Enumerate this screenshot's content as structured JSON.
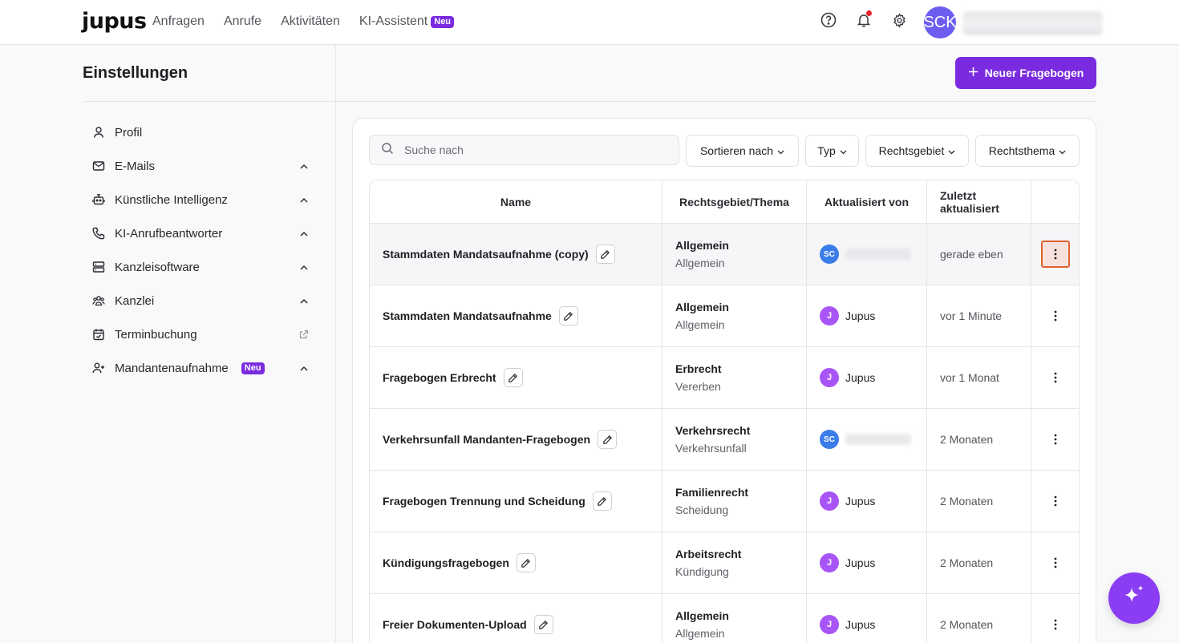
{
  "brand": {
    "logo": "jupus"
  },
  "nav": {
    "links": [
      "Anfragen",
      "Anrufe",
      "Aktivitäten",
      "KI-Assistent"
    ],
    "new_badge": "Neu"
  },
  "user": {
    "initials": "SCK"
  },
  "sidebar": {
    "title": "Einstellungen",
    "items": [
      {
        "label": "Profil",
        "icon": "user-icon"
      },
      {
        "label": "E-Mails",
        "icon": "mail-icon"
      },
      {
        "label": "Künstliche Intelligenz",
        "icon": "robot-icon"
      },
      {
        "label": "KI-Anrufbeantworter",
        "icon": "phone-icon"
      },
      {
        "label": "Kanzleisoftware",
        "icon": "server-icon"
      },
      {
        "label": "Kanzlei",
        "icon": "team-icon"
      },
      {
        "label": "Terminbuchung",
        "icon": "calendar-icon"
      },
      {
        "label": "Mandantenaufnahme",
        "icon": "user-plus-icon",
        "badge": "Neu"
      }
    ]
  },
  "toolbar": {
    "new_button": "Neuer Fragebogen",
    "search_placeholder": "Suche nach",
    "filters": [
      "Sortieren nach",
      "Typ",
      "Rechtsgebiet",
      "Rechtsthema"
    ]
  },
  "table": {
    "columns": [
      "Name",
      "Rechtsgebiet/Thema",
      "Aktualisiert von",
      "Zuletzt aktualisiert"
    ],
    "rows": [
      {
        "name": "Stammdaten Mandatsaufnahme (copy)",
        "area": "Allgemein",
        "topic": "Allgemein",
        "by_initials": "SC",
        "by_name": "",
        "updated": "gerade eben"
      },
      {
        "name": "Stammdaten Mandatsaufnahme",
        "area": "Allgemein",
        "topic": "Allgemein",
        "by_initials": "J",
        "by_name": "Jupus",
        "updated": "vor 1 Minute"
      },
      {
        "name": "Fragebogen Erbrecht",
        "area": "Erbrecht",
        "topic": "Vererben",
        "by_initials": "J",
        "by_name": "Jupus",
        "updated": "vor 1 Monat"
      },
      {
        "name": "Verkehrsunfall Mandanten-Fragebogen",
        "area": "Verkehrsrecht",
        "topic": "Verkehrsunfall",
        "by_initials": "SC",
        "by_name": "",
        "updated": "2 Monaten"
      },
      {
        "name": "Fragebogen Trennung und Scheidung",
        "area": "Familienrecht",
        "topic": "Scheidung",
        "by_initials": "J",
        "by_name": "Jupus",
        "updated": "2 Monaten"
      },
      {
        "name": "Kündigungsfragebogen",
        "area": "Arbeitsrecht",
        "topic": "Kündigung",
        "by_initials": "J",
        "by_name": "Jupus",
        "updated": "2 Monaten"
      },
      {
        "name": "Freier Dokumenten-Upload",
        "area": "Allgemein",
        "topic": "Allgemein",
        "by_initials": "J",
        "by_name": "Jupus",
        "updated": "2 Monaten"
      }
    ]
  },
  "colors": {
    "accent": "#7a2be0",
    "avatar_sc": "#3a7ce8",
    "avatar_j": "#a855f7"
  }
}
